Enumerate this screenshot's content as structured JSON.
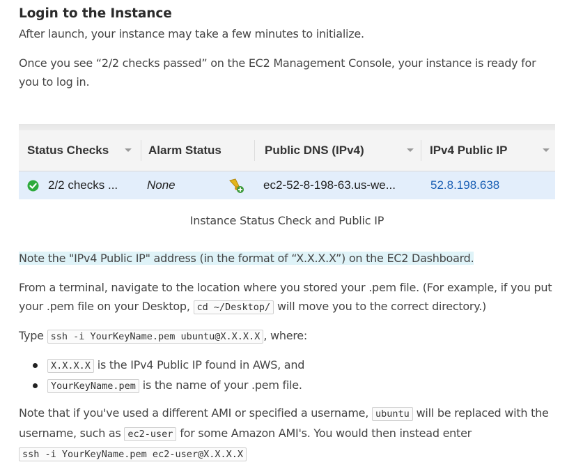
{
  "heading": "Login to the Instance",
  "intro": "After launch, your instance may take a few minutes to initialize.",
  "checks_para": "Once you see “2/2 checks passed” on the EC2 Management Console, your instance is ready for you to log in.",
  "console_table": {
    "headers": {
      "status_checks": "Status Checks",
      "alarm_status": "Alarm Status",
      "public_dns": "Public DNS (IPv4)",
      "ipv4_public_ip": "IPv4 Public IP"
    },
    "row": {
      "status_checks": "2/2 checks ...",
      "alarm_status": "None",
      "public_dns": "ec2-52-8-198-63.us-we...",
      "ipv4_public_ip": "52.8.198.638"
    },
    "colors": {
      "check_green": "#2eaa3c",
      "ip_link": "#1a5fb4",
      "row_bg": "#e3eefb"
    }
  },
  "caption": "Instance Status Check and Public IP",
  "note": "Note the \"IPv4 Public IP\" address (in the format of “X.X.X.X”) on the EC2 Dashboard.",
  "terminal_para": {
    "before": "From a terminal, navigate to the location where you stored your .pem file. (For example, if you put your .pem file on your Desktop,",
    "code": "cd ~/Desktop/",
    "after": "will move you to the correct directory.)"
  },
  "type_para": {
    "before": "Type",
    "code": "ssh -i YourKeyName.pem ubuntu@X.X.X.X",
    "after": ", where:"
  },
  "bullets": [
    {
      "code": "X.X.X.X",
      "text": "is the IPv4 Public IP found in AWS, and"
    },
    {
      "code": "YourKeyName.pem",
      "text": "is the name of your .pem file."
    }
  ],
  "ami_para": {
    "part1": "Note that if you've used a different AMI or specified a username,",
    "code1": "ubuntu",
    "part2": "will be replaced with the username, such as",
    "code2": "ec2-user",
    "part3": "for some Amazon AMI's. You would then instead enter",
    "code3": "ssh -i YourKeyName.pem ec2-user@X.X.X.X"
  },
  "icons": [
    "check-circle-icon",
    "alarm-bell-add-icon",
    "sort-caret-icon"
  ]
}
